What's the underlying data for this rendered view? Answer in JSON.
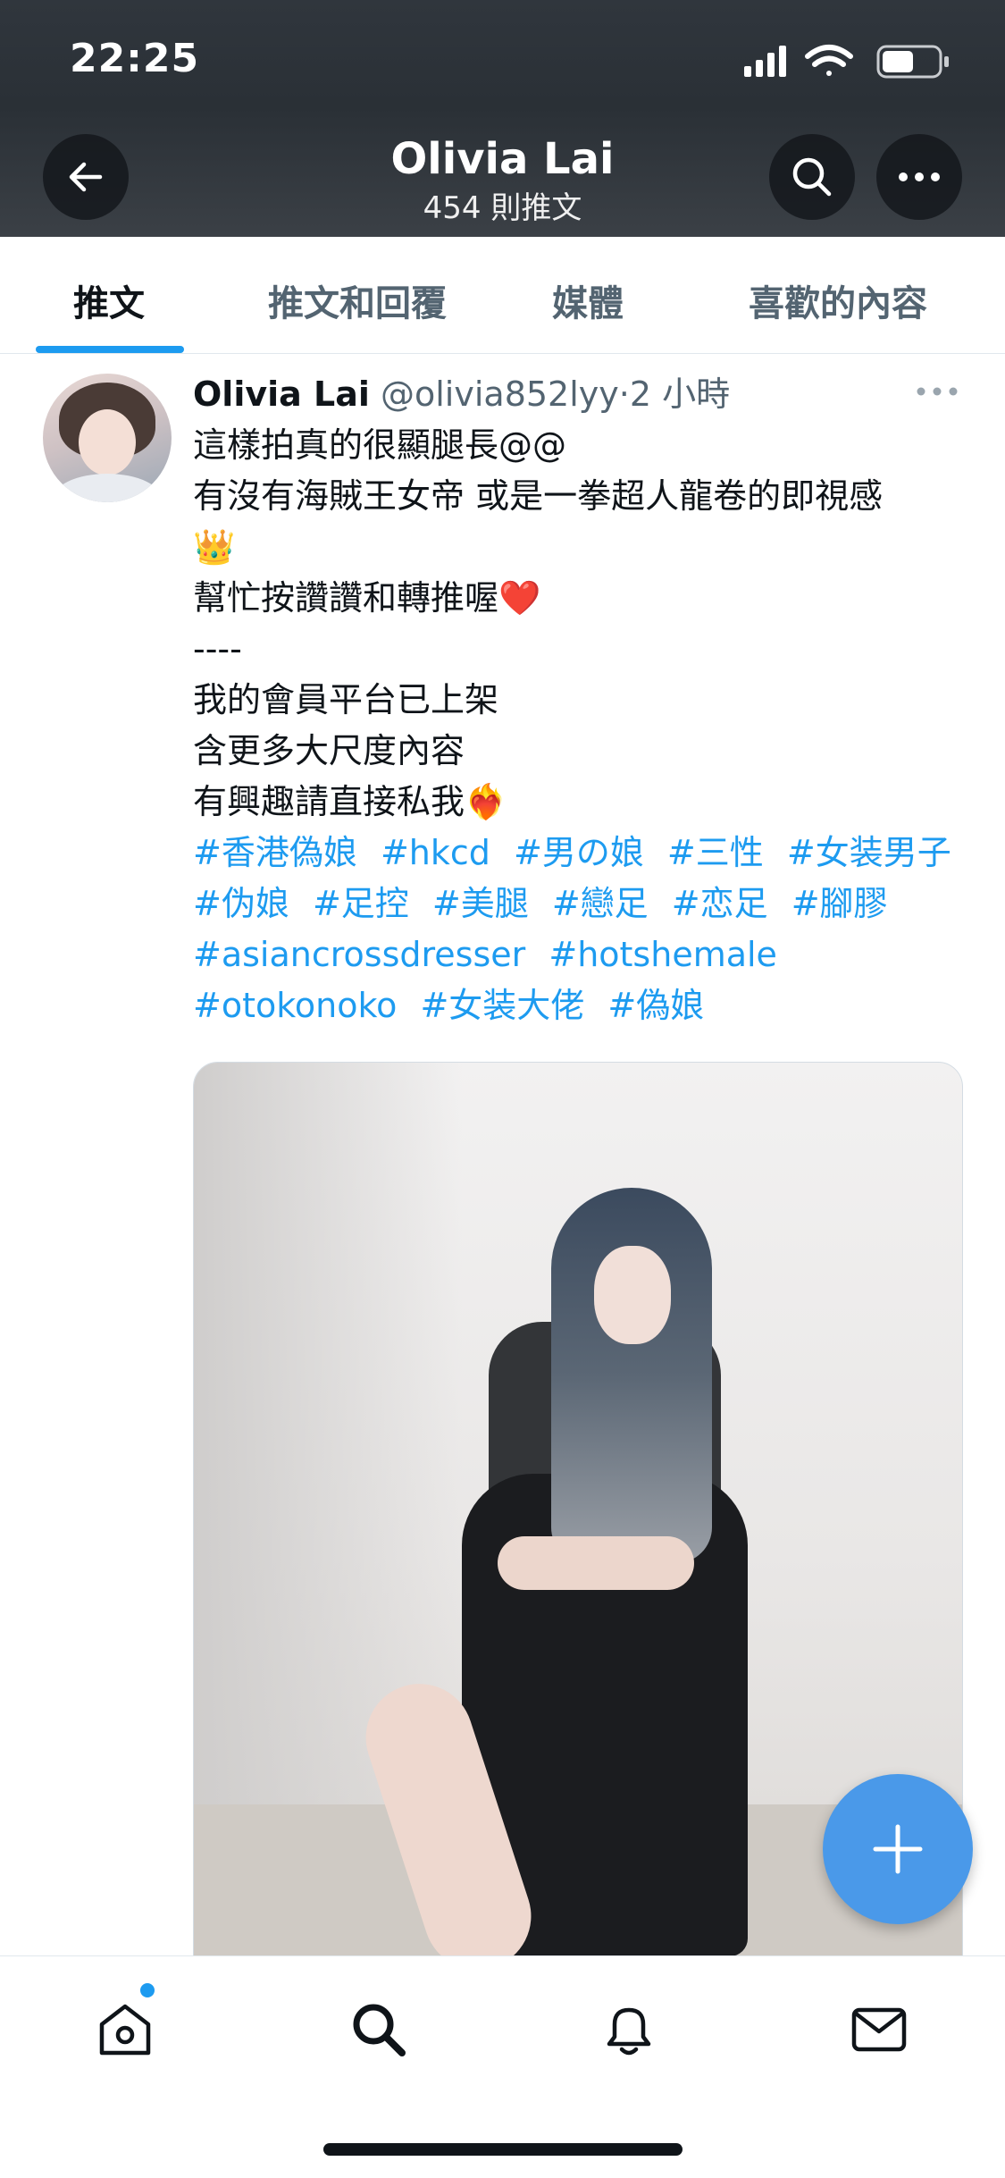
{
  "status_bar": {
    "time": "22:25"
  },
  "header": {
    "profile_name": "Olivia Lai",
    "tweet_count": "454 則推文",
    "back_icon": "arrow-left-icon",
    "search_icon": "search-icon",
    "more_icon": "more-horizontal-icon"
  },
  "tabs": [
    {
      "label": "推文",
      "active": true
    },
    {
      "label": "推文和回覆",
      "active": false
    },
    {
      "label": "媒體",
      "active": false
    },
    {
      "label": "喜歡的內容",
      "active": false
    }
  ],
  "tweet": {
    "author": "Olivia Lai",
    "handle": "@olivia852lyy",
    "separator": "·",
    "time": "2 小時",
    "lines": [
      "這樣拍真的很顯腿長@@",
      "有沒有海賊王女帝 或是一拳超人龍卷的即視感",
      "👑",
      "幫忙按讚讚和轉推喔❤️",
      "----",
      "我的會員平台已上架",
      "含更多大尺度內容",
      "有興趣請直接私我❤️‍🔥"
    ],
    "hashtag_lines": [
      [
        "#香港偽娘",
        "#hkcd",
        "#男の娘",
        "#三性",
        "#女装男子"
      ],
      [
        "#伪娘",
        "#足控",
        "#美腿",
        "#戀足",
        "#恋足",
        "#腳膠"
      ],
      [
        "#asiancrossdresser",
        "#hotshemale"
      ],
      [
        "#otokonoko",
        "#女装大佬",
        "#偽娘"
      ]
    ]
  },
  "fab_icon": "plus-icon",
  "bottom_nav": {
    "home_icon": "home-icon",
    "search_icon": "search-icon",
    "notifications_icon": "bell-icon",
    "messages_icon": "mail-icon"
  },
  "colors": {
    "accent": "#1d9bf0",
    "fab": "#4a99e9",
    "text": "#0f1419",
    "secondary_text": "#536471"
  }
}
